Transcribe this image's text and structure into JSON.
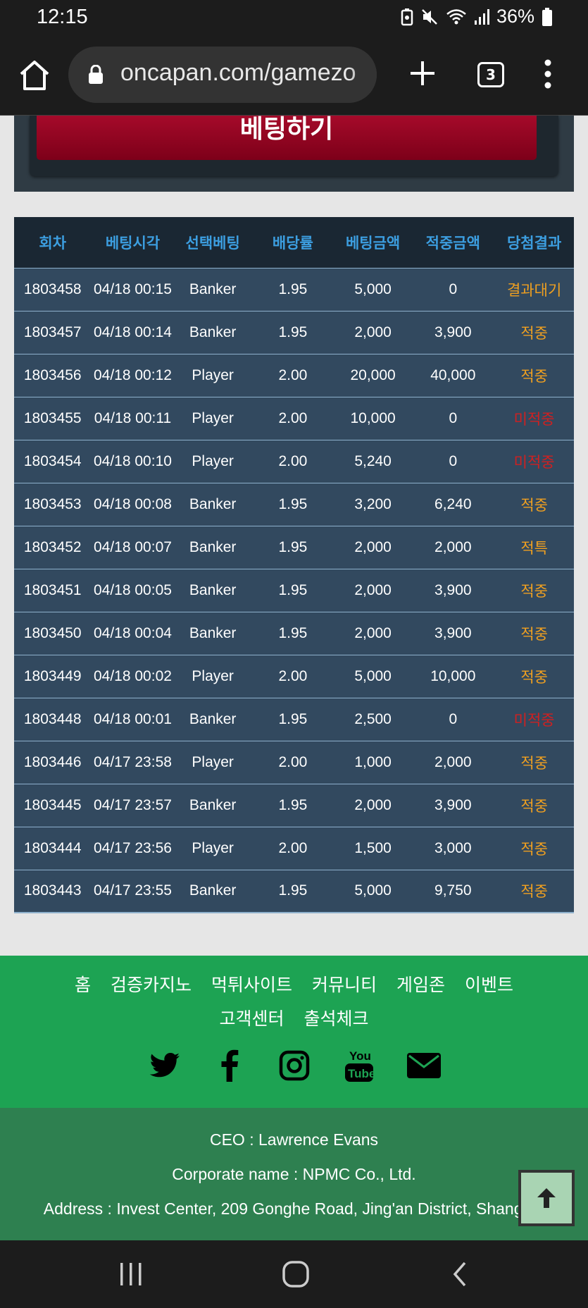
{
  "status": {
    "time": "12:15",
    "battery": "36%"
  },
  "browser": {
    "url": "oncapan.com/gamezo",
    "tab_count": "3"
  },
  "bet_button_label": "베팅하기",
  "table": {
    "headers": [
      "회차",
      "베팅시각",
      "선택베팅",
      "배당률",
      "베팅금액",
      "적중금액",
      "당첨결과"
    ],
    "rows": [
      {
        "round": "1803458",
        "time": "04/18 00:15",
        "pick": "Banker",
        "odds": "1.95",
        "bet": "5,000",
        "win": "0",
        "result": "결과대기",
        "status": "wait"
      },
      {
        "round": "1803457",
        "time": "04/18 00:14",
        "pick": "Banker",
        "odds": "1.95",
        "bet": "2,000",
        "win": "3,900",
        "result": "적중",
        "status": "win"
      },
      {
        "round": "1803456",
        "time": "04/18 00:12",
        "pick": "Player",
        "odds": "2.00",
        "bet": "20,000",
        "win": "40,000",
        "result": "적중",
        "status": "win"
      },
      {
        "round": "1803455",
        "time": "04/18 00:11",
        "pick": "Player",
        "odds": "2.00",
        "bet": "10,000",
        "win": "0",
        "result": "미적중",
        "status": "lose"
      },
      {
        "round": "1803454",
        "time": "04/18 00:10",
        "pick": "Player",
        "odds": "2.00",
        "bet": "5,240",
        "win": "0",
        "result": "미적중",
        "status": "lose"
      },
      {
        "round": "1803453",
        "time": "04/18 00:08",
        "pick": "Banker",
        "odds": "1.95",
        "bet": "3,200",
        "win": "6,240",
        "result": "적중",
        "status": "win"
      },
      {
        "round": "1803452",
        "time": "04/18 00:07",
        "pick": "Banker",
        "odds": "1.95",
        "bet": "2,000",
        "win": "2,000",
        "result": "적특",
        "status": "win"
      },
      {
        "round": "1803451",
        "time": "04/18 00:05",
        "pick": "Banker",
        "odds": "1.95",
        "bet": "2,000",
        "win": "3,900",
        "result": "적중",
        "status": "win"
      },
      {
        "round": "1803450",
        "time": "04/18 00:04",
        "pick": "Banker",
        "odds": "1.95",
        "bet": "2,000",
        "win": "3,900",
        "result": "적중",
        "status": "win"
      },
      {
        "round": "1803449",
        "time": "04/18 00:02",
        "pick": "Player",
        "odds": "2.00",
        "bet": "5,000",
        "win": "10,000",
        "result": "적중",
        "status": "win"
      },
      {
        "round": "1803448",
        "time": "04/18 00:01",
        "pick": "Banker",
        "odds": "1.95",
        "bet": "2,500",
        "win": "0",
        "result": "미적중",
        "status": "lose"
      },
      {
        "round": "1803446",
        "time": "04/17 23:58",
        "pick": "Player",
        "odds": "2.00",
        "bet": "1,000",
        "win": "2,000",
        "result": "적중",
        "status": "win"
      },
      {
        "round": "1803445",
        "time": "04/17 23:57",
        "pick": "Banker",
        "odds": "1.95",
        "bet": "2,000",
        "win": "3,900",
        "result": "적중",
        "status": "win"
      },
      {
        "round": "1803444",
        "time": "04/17 23:56",
        "pick": "Player",
        "odds": "2.00",
        "bet": "1,500",
        "win": "3,000",
        "result": "적중",
        "status": "win"
      },
      {
        "round": "1803443",
        "time": "04/17 23:55",
        "pick": "Banker",
        "odds": "1.95",
        "bet": "5,000",
        "win": "9,750",
        "result": "적중",
        "status": "win"
      }
    ]
  },
  "footer": {
    "nav_row1": [
      "홈",
      "검증카지노",
      "먹튀사이트",
      "커뮤니티",
      "게임존",
      "이벤트"
    ],
    "nav_row2": [
      "고객센터",
      "출석체크"
    ],
    "social_icons": [
      "twitter-icon",
      "facebook-icon",
      "instagram-icon",
      "youtube-icon",
      "email-icon"
    ],
    "ceo": "CEO : Lawrence Evans",
    "corporate": "Corporate name : NPMC Co., Ltd.",
    "address": "Address : Invest Center, 209 Gonghe Road, Jing'an District, Shanghai"
  },
  "colors": {
    "header_text": "#3c9ee0",
    "row_bg": "#32495f",
    "win": "#f0a020",
    "lose": "#d02020",
    "footer_nav": "#1da353",
    "footer_info": "#2e8050"
  }
}
